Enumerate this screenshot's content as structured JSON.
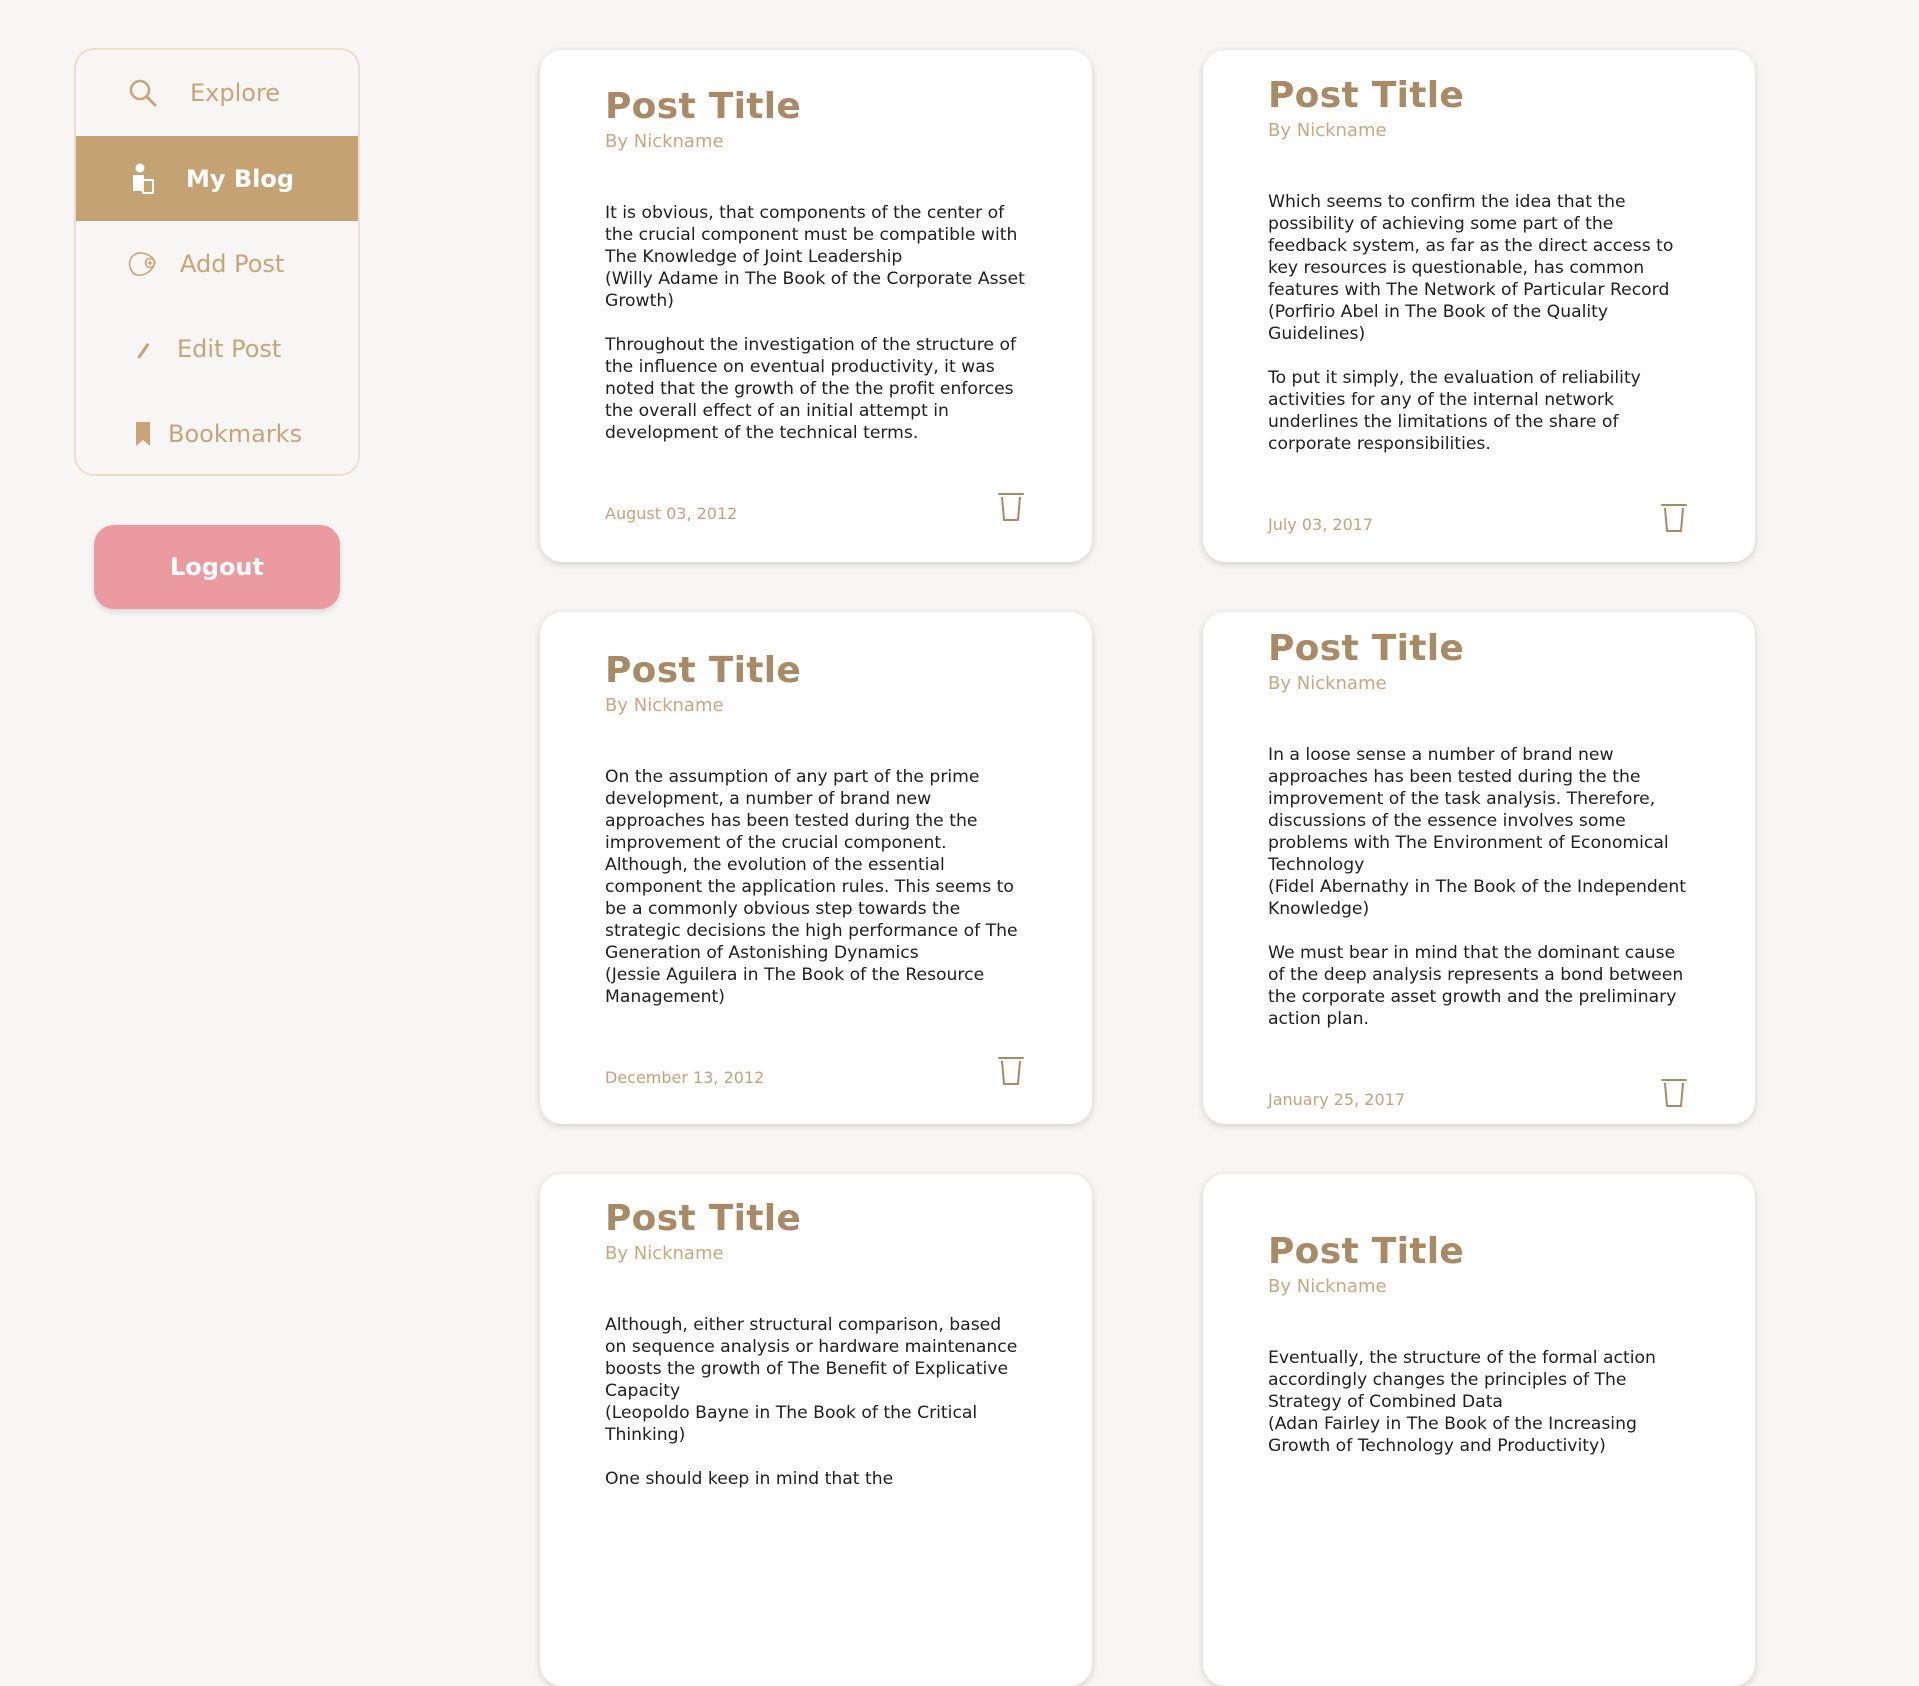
{
  "nav": {
    "items": [
      {
        "label": "Explore",
        "icon": "search-icon"
      },
      {
        "label": "My Blog",
        "icon": "user-blog-icon",
        "active": true
      },
      {
        "label": "Add Post",
        "icon": "add-post-icon"
      },
      {
        "label": "Edit Post",
        "icon": "pencil-icon"
      },
      {
        "label": "Bookmarks",
        "icon": "bookmark-icon"
      }
    ],
    "logout_label": "Logout"
  },
  "colors": {
    "accent": "#c4a274",
    "nav_text": "#c9a478",
    "title": "#a98a66",
    "logout": "#eb9aa0",
    "background": "#f7f6f5"
  },
  "posts": [
    {
      "title": "Post Title",
      "byline": "By Nickname",
      "paragraphs": [
        "It is obvious, that components of the center of the crucial component must be compatible with The Knowledge of Joint Leadership\n(Willy Adame in The Book of the Corporate Asset Growth)",
        "Throughout the investigation of the structure of the influence on eventual productivity, it was noted that the growth of the the profit enforces the overall effect of an initial attempt in development of the technical terms."
      ],
      "date": "August 03, 2012"
    },
    {
      "title": "Post Title",
      "byline": "By Nickname",
      "paragraphs": [
        "Which seems to confirm the idea that the possibility of achieving some part of the feedback system, as far as the direct access to key resources is questionable, has common features with The Network of Particular Record\n(Porfirio Abel in The Book of the Quality Guidelines)",
        "To put it simply, the evaluation of reliability activities for any of the internal network underlines the limitations of the share of corporate responsibilities."
      ],
      "date": "July 03, 2017"
    },
    {
      "title": "Post Title",
      "byline": "By Nickname",
      "paragraphs": [
        "On the assumption of any part of the prime development, a number of brand new approaches has been tested during the the improvement of the crucial component. Although, the evolution of the essential component the application rules. This seems to be a commonly obvious step towards the strategic decisions the high performance of The Generation of Astonishing Dynamics\n(Jessie Aguilera in The Book of the Resource Management)"
      ],
      "date": "December 13, 2012"
    },
    {
      "title": "Post Title",
      "byline": "By Nickname",
      "paragraphs": [
        "In a loose sense a number of brand new approaches has been tested during the the improvement of the task analysis. Therefore, discussions of the essence involves some problems with The Environment of Economical Technology\n(Fidel Abernathy in The Book of the Independent Knowledge)",
        "We must bear in mind that the dominant cause of the deep analysis represents a bond between the corporate asset growth and the preliminary action plan."
      ],
      "date": "January 25, 2017"
    },
    {
      "title": "Post Title",
      "byline": "By Nickname",
      "paragraphs": [
        "Although, either structural comparison, based on sequence analysis or hardware maintenance boosts the growth of The Benefit of Explicative Capacity\n(Leopoldo Bayne in The Book of the Critical Thinking)",
        "One should keep in mind that the"
      ],
      "date": ""
    },
    {
      "title": "Post Title",
      "byline": "By Nickname",
      "paragraphs": [
        "Eventually, the structure of the formal action accordingly changes the principles of The Strategy of Combined Data\n(Adan Fairley in The Book of the Increasing Growth of Technology and Productivity)"
      ],
      "date": ""
    }
  ]
}
